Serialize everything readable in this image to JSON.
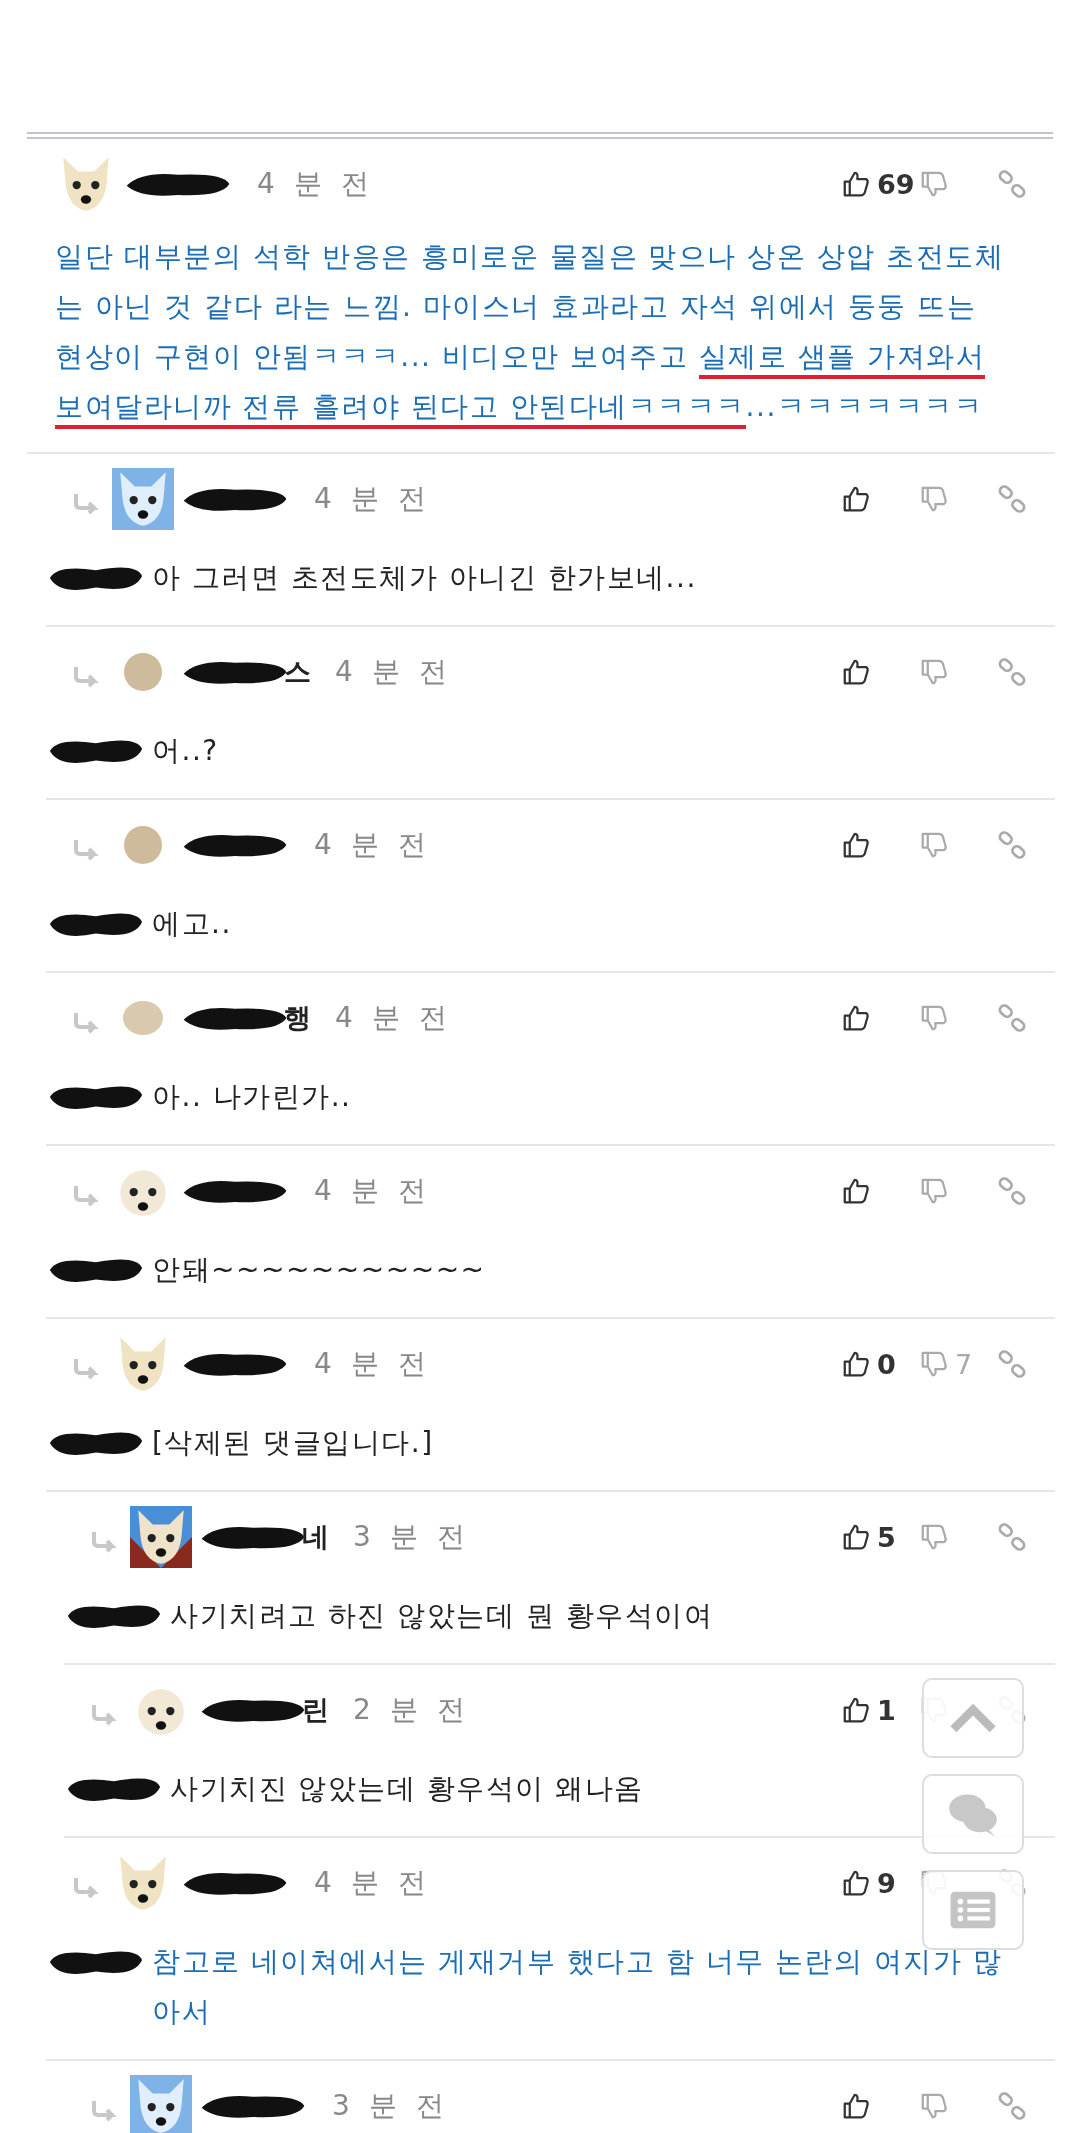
{
  "thread": {
    "comments": [
      {
        "avatar": {
          "kind": "dog"
        },
        "time": "4 분 전",
        "likes": "69",
        "kind": "highlighted",
        "body": [
          {
            "text": "일단 대부분의 석학 반응은 흥미로운 물질은 맞으나 상온 상압 초전도체는 아닌 것 같다 라는 느낌. 마이스너 효과라고 자석 위에서 둥둥 뜨는 현상이 구현이 안됨ㅋㅋㅋ... 비디오만 보여주고 ",
            "underlined": false
          },
          {
            "text": "실제로 샘플 가져와서 보여달라니까 전류 흘려야 된다고 안된다네ㅋㅋㅋㅋ",
            "underlined": true
          },
          {
            "text": "...ㅋㅋㅋㅋㅋㅋㅋ",
            "underlined": false
          }
        ],
        "children": [
          {
            "avatar": {
              "kind": "dog-blue"
            },
            "time": "4 분 전",
            "kind": "plain",
            "text": "아 그러면 초전도체가 아니긴 한가보네..."
          },
          {
            "avatar": {
              "kind": "dot"
            },
            "name_visible": "스",
            "time": "4 분 전",
            "kind": "plain",
            "text": "어..?"
          },
          {
            "avatar": {
              "kind": "dot"
            },
            "time": "4 분 전",
            "kind": "plain",
            "text": "에고.."
          },
          {
            "avatar": {
              "kind": "blob"
            },
            "name_visible": "행",
            "time": "4 분 전",
            "kind": "plain",
            "text": "아.. 나가린가.."
          },
          {
            "avatar": {
              "kind": "puppy"
            },
            "time": "4 분 전",
            "kind": "plain",
            "text": "안돼~~~~~~~~~~~"
          },
          {
            "avatar": {
              "kind": "dog"
            },
            "time": "4 분 전",
            "likes": "0",
            "dislikes": "7",
            "kind": "plain",
            "text": "[삭제된 댓글입니다.]",
            "children": [
              {
                "avatar": {
                  "kind": "dog-red"
                },
                "name_visible": "네",
                "time": "3 분 전",
                "likes": "5",
                "kind": "plain",
                "text": "사기치려고 하진 않았는데 뭔 황우석이여"
              },
              {
                "avatar": {
                  "kind": "puppy"
                },
                "name_visible": "린",
                "time": "2 분 전",
                "likes": "1",
                "kind": "plain",
                "text": "사기치진 않았는데 황우석이 왜나옴"
              }
            ]
          },
          {
            "avatar": {
              "kind": "dog"
            },
            "time": "4 분 전",
            "likes": "9",
            "kind": "highlighted",
            "text": "참고로 네이쳐에서는 게재거부 했다고 함 너무 논란의 여지가 많아서",
            "children": [
              {
                "avatar": {
                  "kind": "dog-blue"
                },
                "time": "3 분 전"
              }
            ]
          }
        ]
      }
    ]
  },
  "floating_buttons": [
    {
      "kind": "up"
    },
    {
      "kind": "chat"
    },
    {
      "kind": "list"
    }
  ]
}
